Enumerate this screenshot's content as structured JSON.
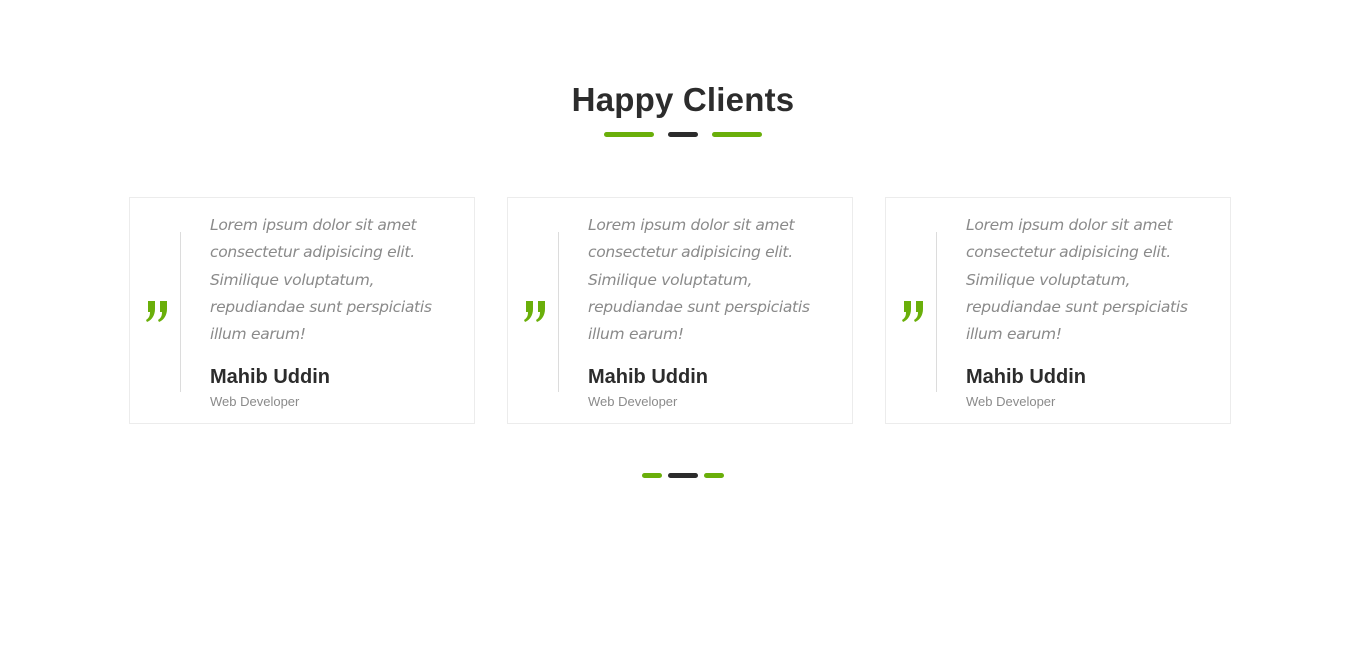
{
  "section": {
    "title": "Happy Clients"
  },
  "colors": {
    "accent": "#6aaf0a",
    "dark": "#2c2c2c",
    "muted_text": "#8a8a8a",
    "border": "#ececec"
  },
  "testimonials": [
    {
      "quote_icon": "quote-icon",
      "text": "Lorem ipsum dolor sit amet consectetur adipisicing elit. Similique voluptatum, repudiandae sunt perspiciatis illum earum!",
      "name": "Mahib Uddin",
      "role": "Web Developer"
    },
    {
      "quote_icon": "quote-icon",
      "text": "Lorem ipsum dolor sit amet consectetur adipisicing elit. Similique voluptatum, repudiandae sunt perspiciatis illum earum!",
      "name": "Mahib Uddin",
      "role": "Web Developer"
    },
    {
      "quote_icon": "quote-icon",
      "text": "Lorem ipsum dolor sit amet consectetur adipisicing elit. Similique voluptatum, repudiandae sunt perspiciatis illum earum!",
      "name": "Mahib Uddin",
      "role": "Web Developer"
    }
  ],
  "pager": {
    "active_index": 1
  }
}
